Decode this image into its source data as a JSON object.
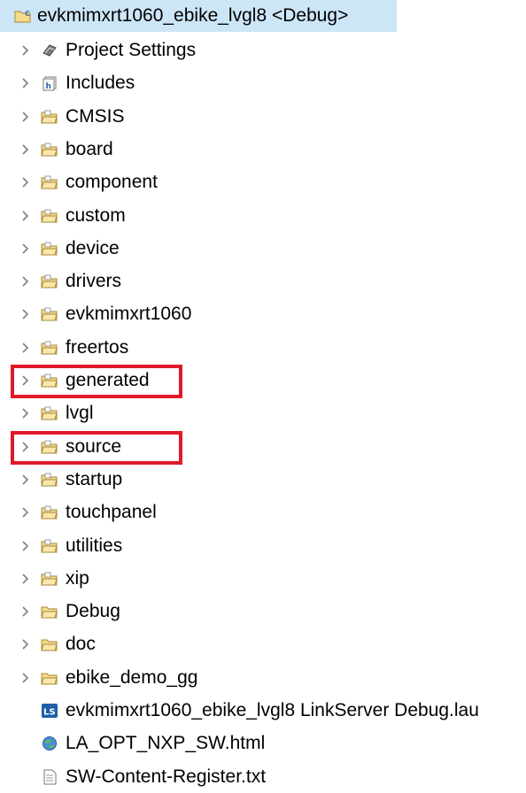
{
  "root": {
    "label": "evkmimxrt1060_ebike_lvgl8 <Debug>",
    "icon": "c-project-icon"
  },
  "items": [
    {
      "label": "Project Settings",
      "icon": "settings-icon",
      "expandable": true
    },
    {
      "label": "Includes",
      "icon": "includes-icon",
      "expandable": true
    },
    {
      "label": "CMSIS",
      "icon": "source-folder-icon",
      "expandable": true
    },
    {
      "label": "board",
      "icon": "source-folder-icon",
      "expandable": true
    },
    {
      "label": "component",
      "icon": "source-folder-icon",
      "expandable": true
    },
    {
      "label": "custom",
      "icon": "source-folder-icon",
      "expandable": true
    },
    {
      "label": "device",
      "icon": "source-folder-icon",
      "expandable": true
    },
    {
      "label": "drivers",
      "icon": "source-folder-icon",
      "expandable": true
    },
    {
      "label": "evkmimxrt1060",
      "icon": "source-folder-icon",
      "expandable": true
    },
    {
      "label": "freertos",
      "icon": "source-folder-icon",
      "expandable": true
    },
    {
      "label": "generated",
      "icon": "source-folder-icon",
      "expandable": true,
      "highlighted": true
    },
    {
      "label": "lvgl",
      "icon": "source-folder-icon",
      "expandable": true
    },
    {
      "label": "source",
      "icon": "source-folder-icon",
      "expandable": true,
      "highlighted": true
    },
    {
      "label": "startup",
      "icon": "source-folder-icon",
      "expandable": true
    },
    {
      "label": "touchpanel",
      "icon": "source-folder-icon",
      "expandable": true
    },
    {
      "label": "utilities",
      "icon": "source-folder-icon",
      "expandable": true
    },
    {
      "label": "xip",
      "icon": "source-folder-icon",
      "expandable": true
    },
    {
      "label": "Debug",
      "icon": "folder-icon",
      "expandable": true
    },
    {
      "label": "doc",
      "icon": "folder-icon",
      "expandable": true
    },
    {
      "label": "ebike_demo_gg",
      "icon": "folder-icon",
      "expandable": true
    },
    {
      "label": "evkmimxrt1060_ebike_lvgl8 LinkServer Debug.lau",
      "icon": "linkserver-launch-icon",
      "expandable": false
    },
    {
      "label": "LA_OPT_NXP_SW.html",
      "icon": "html-file-icon",
      "expandable": false
    },
    {
      "label": "SW-Content-Register.txt",
      "icon": "text-file-icon",
      "expandable": false
    }
  ],
  "colors": {
    "selection": "#cde6f7",
    "highlight_border": "#e0192a",
    "chevron": "#808080"
  }
}
